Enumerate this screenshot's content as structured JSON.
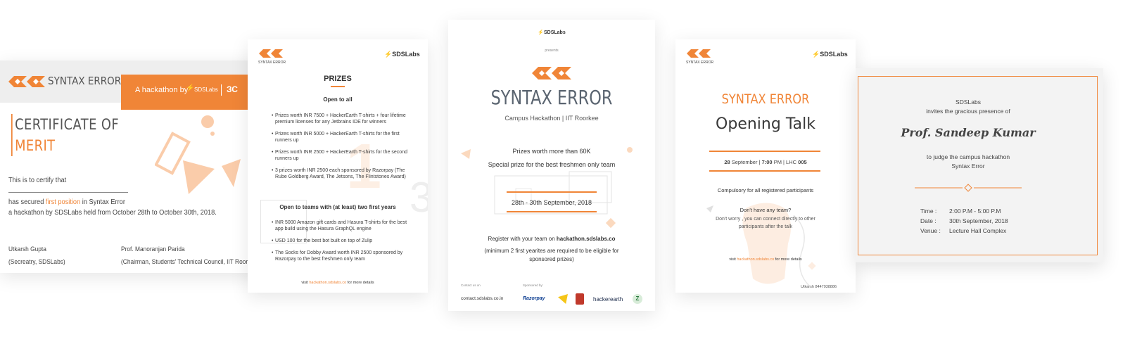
{
  "certificate": {
    "brand": "SYNTAX ERROR",
    "hackathon_by": "A hackathon by",
    "sds_logo_text": "SDSLabs",
    "title_line1": "CERTIFICATE OF",
    "title_line2": "MERIT",
    "certify": "This is to certify that",
    "secured_prefix": "has secured",
    "secured_highlight": "first position",
    "secured_suffix": "in Syntax Error",
    "details": "a hackathon by SDSLabs held from October 28th to October 30th, 2018.",
    "signer1_name": "Utkarsh Gupta",
    "signer1_role": "(Secreatry, SDSLabs)",
    "signer2_name": "Prof. Manoranjan Parida",
    "signer2_role": "(Chairman, Students' Technical Council, IIT Roorkee)"
  },
  "prizes": {
    "logo_caption": "SYNTAX ERROR",
    "sds_logo_text": "SDSLabs",
    "title": "PRIZES",
    "section1": "Open to all",
    "items1": [
      "Prizes worth  INR 7500 + HackerEarth T-shirts + four lifetime premium licenses for any Jetbrains IDE for winners",
      "Prizes worth INR 5000 + HackerEarth T-shirts for the first runners up",
      "Prizes worth INR 2500 + HackerEarth T-shirts for the second runners up",
      "3 prizes worth INR 2500 each sponsored by Razorpay (The Rube Goldberg Award, The Jetsons, The Flintstones Award)"
    ],
    "section2": "Open to teams with (at least) two first years",
    "items2": [
      "INR 5000 Amazon gift cards and Hasura T-shirts for the best app build using the Hasura GraphQL engine",
      "USD 100 for the best bot built on top of Zulip",
      "The Socks for Dobby Award worth INR 2500 sponsored by Razorpay to the best freshmen only team"
    ],
    "visit_prefix": "visit",
    "visit_link": "hackathon.sdslabs.co",
    "visit_suffix": "for more details"
  },
  "poster": {
    "sds_logo_text": "SDSLabs",
    "presents": "presents",
    "title": "SYNTAX ERROR",
    "subtitle": "Campus Hackathon | IIT Roorkee",
    "prize_line1": "Prizes worth more than 60K",
    "prize_line2": "Special prize for the best freshmen only team",
    "dates": "28th - 30th September, 2018",
    "register_prefix": "Register with your team on",
    "register_link": "hackathon.sdslabs.co",
    "minimum": "(minimum 2 first yearites are required to be eligible for sponsored prizes)",
    "contact_label": "Contact us on",
    "contact": "contact.sdslabs.co.in",
    "sponsored_label": "Sponsored by:",
    "sponsors": [
      "Razorpay",
      "hackerearth",
      "Z"
    ]
  },
  "talk": {
    "logo_caption": "SYNTAX ERROR",
    "sds_logo_text": "SDSLabs",
    "title": "SYNTAX ERROR",
    "heading": "Opening Talk",
    "schedule": {
      "day": "28",
      "month": "September |",
      "time": "7:00",
      "pm": "PM | LHC",
      "room": "005"
    },
    "compulsory": "Compulsory for all registered participants",
    "no_team_q": "Don't have any team?",
    "no_team_a": "Don't worry , you can connect directly to other participants after the talk",
    "visit_prefix": "visit",
    "visit_link": "hackathon.sdslabs.co",
    "visit_suffix": "for more details",
    "contact": "Utkarsh 8447938886"
  },
  "invite": {
    "org": "SDSLabs",
    "invites": "invites the gracious presence of",
    "name": "Prof. Sandeep Kumar",
    "purpose_line1": "to judge the campus hackathon",
    "purpose_line2": "Syntax Error",
    "time_label": "Time :",
    "time_value": "2:00 P.M - 5:00 P.M",
    "date_label": "Date :",
    "date_value": "30th September, 2018",
    "venue_label": "Venue :",
    "venue_value": "Lecture Hall Complex"
  },
  "colors": {
    "accent": "#f08537",
    "title_grey": "#5a6470",
    "bg_grey": "#eeeeee"
  }
}
